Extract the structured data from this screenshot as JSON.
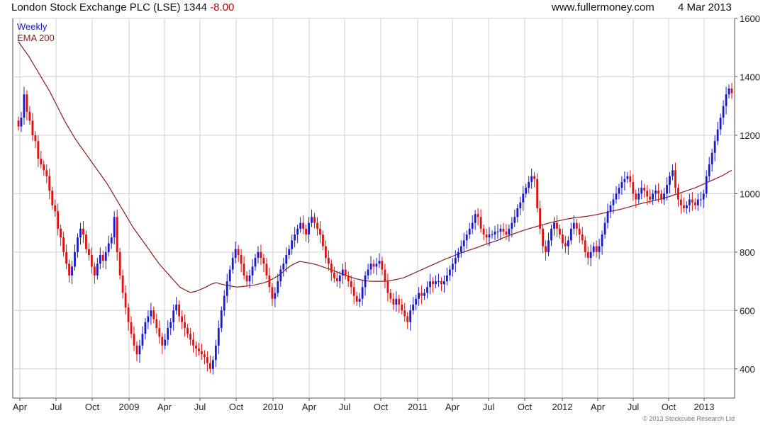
{
  "header": {
    "title": "London Stock Exchange PLC (LSE) 1344",
    "change": "-8.00",
    "site": "www.fullermoney.com",
    "date": "4 Mar 2013"
  },
  "legend": {
    "weekly": "Weekly",
    "ema": "EMA 200"
  },
  "copyright": "© 2013 Stockcube Research Ltd",
  "colors": {
    "up": "#1a1acc",
    "down": "#dd1111",
    "ema": "#8b1a1a",
    "grid": "#cfcfcf"
  },
  "chart_data": {
    "type": "candlestick",
    "ylim": [
      300,
      1600
    ],
    "y_ticks": [
      400,
      600,
      800,
      1000,
      1200,
      1400,
      1600
    ],
    "x_ticks": [
      "Apr",
      "Jul",
      "Oct",
      "2009",
      "Apr",
      "Jul",
      "Oct",
      "2010",
      "Apr",
      "Jul",
      "Oct",
      "2011",
      "Apr",
      "Jul",
      "Oct",
      "2012",
      "Apr",
      "Jul",
      "Oct",
      "2013"
    ],
    "grid": true,
    "legend_position": "top-left",
    "weekly_close": [
      1230,
      1260,
      1340,
      1280,
      1250,
      1200,
      1180,
      1120,
      1100,
      1080,
      1060,
      1010,
      960,
      940,
      880,
      850,
      800,
      760,
      720,
      750,
      800,
      850,
      880,
      860,
      810,
      790,
      750,
      720,
      760,
      790,
      770,
      800,
      830,
      850,
      920,
      800,
      720,
      660,
      610,
      560,
      520,
      480,
      450,
      480,
      520,
      560,
      580,
      600,
      570,
      540,
      510,
      480,
      500,
      540,
      560,
      600,
      620,
      580,
      560,
      540,
      520,
      500,
      480,
      470,
      460,
      450,
      440,
      420,
      400,
      430,
      480,
      540,
      600,
      650,
      700,
      740,
      780,
      810,
      790,
      760,
      720,
      700,
      720,
      750,
      780,
      800,
      780,
      760,
      720,
      680,
      640,
      660,
      700,
      740,
      760,
      790,
      810,
      840,
      860,
      880,
      900,
      880,
      860,
      900,
      920,
      900,
      880,
      860,
      820,
      780,
      760,
      730,
      710,
      700,
      720,
      740,
      720,
      700,
      680,
      650,
      630,
      640,
      680,
      720,
      740,
      760,
      750,
      760,
      770,
      740,
      700,
      660,
      640,
      620,
      640,
      620,
      600,
      580,
      560,
      600,
      620,
      640,
      660,
      650,
      660,
      680,
      700,
      690,
      700,
      700,
      690,
      700,
      720,
      740,
      760,
      780,
      800,
      820,
      840,
      860,
      880,
      900,
      930,
      920,
      880,
      860,
      850,
      860,
      860,
      870,
      870,
      880,
      870,
      860,
      880,
      900,
      920,
      950,
      970,
      1000,
      1020,
      1040,
      1060,
      1050,
      950,
      880,
      820,
      800,
      840,
      880,
      900,
      880,
      860,
      830,
      820,
      840,
      880,
      900,
      880,
      860,
      840,
      800,
      780,
      800,
      820,
      800,
      820,
      860,
      900,
      940,
      960,
      980,
      1000,
      1020,
      1040,
      1050,
      1060,
      1040,
      1000,
      980,
      1000,
      1020,
      1010,
      990,
      980,
      1000,
      1010,
      1000,
      980,
      1000,
      1030,
      1060,
      1080,
      1020,
      980,
      960,
      950,
      960,
      980,
      970,
      960,
      980,
      980,
      1000,
      1060,
      1100,
      1140,
      1180,
      1220,
      1260,
      1300,
      1340,
      1360,
      1344
    ],
    "ema_200": [
      1520,
      1495,
      1470,
      1440,
      1410,
      1380,
      1350,
      1315,
      1280,
      1245,
      1215,
      1185,
      1160,
      1135,
      1110,
      1085,
      1060,
      1035,
      1005,
      975,
      945,
      915,
      885,
      860,
      835,
      810,
      785,
      760,
      740,
      720,
      700,
      680,
      670,
      662,
      665,
      672,
      680,
      690,
      695,
      690,
      686,
      683,
      680,
      682,
      684,
      686,
      690,
      694,
      700,
      710,
      720,
      735,
      750,
      760,
      768,
      765,
      762,
      758,
      752,
      746,
      740,
      733,
      726,
      719,
      713,
      708,
      704,
      701,
      700,
      700,
      700,
      701,
      704,
      708,
      712,
      720,
      728,
      736,
      744,
      752,
      760,
      768,
      776,
      783,
      790,
      797,
      803,
      809,
      815,
      822,
      828,
      834,
      840,
      848,
      855,
      862,
      868,
      874,
      880,
      885,
      890,
      895,
      900,
      904,
      908,
      912,
      915,
      918,
      920,
      922,
      925,
      928,
      932,
      936,
      940,
      944,
      948,
      953,
      958,
      963,
      968,
      972,
      976,
      980,
      985,
      990,
      996,
      1002,
      1008,
      1014,
      1020,
      1028,
      1036,
      1044,
      1052,
      1060,
      1070,
      1080
    ]
  }
}
